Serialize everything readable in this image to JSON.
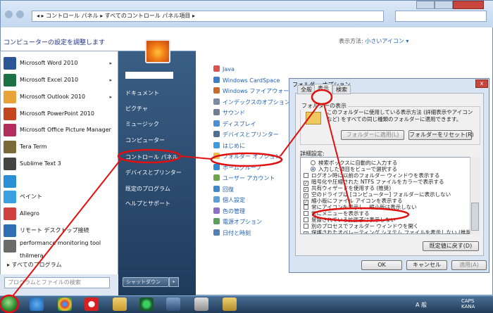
{
  "address": {
    "path": "◂  ▸  コントロール パネル  ▸  すべてのコントロール パネル項目  ▸"
  },
  "control_panel": {
    "heading": "コンピューターの設定を調整します",
    "view_label": "表示方法:",
    "view_value": "小さいアイコン ▾",
    "items": [
      {
        "label": "Java",
        "color": "#d9534f"
      },
      {
        "label": "Windows CardSpace",
        "color": "#3f7ec8"
      },
      {
        "label": "Windows ファイアウォール",
        "color": "#c96b2c"
      },
      {
        "label": "インデックスのオプション",
        "color": "#7a8aa0"
      },
      {
        "label": "サウンド",
        "color": "#6f7f8f"
      },
      {
        "label": "ディスプレイ",
        "color": "#4b8fd6"
      },
      {
        "label": "デバイスとプリンター",
        "color": "#4f6f8f"
      },
      {
        "label": "はじめに",
        "color": "#3b9be0"
      },
      {
        "label": "フォルダー オプション",
        "color": "#e8c04a"
      },
      {
        "label": "ホームグループ",
        "color": "#2d8bd6"
      },
      {
        "label": "ユーザー アカウント",
        "color": "#6fa34a"
      },
      {
        "label": "回復",
        "color": "#3f88c7"
      },
      {
        "label": "個人設定",
        "color": "#5a9fd6"
      },
      {
        "label": "色の管理",
        "color": "#8a6fc4"
      },
      {
        "label": "電源オプション",
        "color": "#58a05a"
      },
      {
        "label": "日付と時刻",
        "color": "#4f7fb5"
      }
    ]
  },
  "start_menu": {
    "programs": [
      {
        "label": "Microsoft Word 2010",
        "color": "#2b5797",
        "arrow": "▸"
      },
      {
        "label": "Microsoft Excel 2010",
        "color": "#1e7145",
        "arrow": "▸"
      },
      {
        "label": "Microsoft Outlook 2010",
        "color": "#e8a33a",
        "arrow": "▸"
      },
      {
        "label": "Microsoft PowerPoint 2010",
        "color": "#c4451d",
        "arrow": ""
      },
      {
        "label": "Microsoft Office Picture Manager",
        "color": "#b22d5b",
        "arrow": ""
      },
      {
        "label": "Tera Term",
        "color": "#7b6a3a",
        "arrow": ""
      },
      {
        "label": "Sublime Text 3",
        "color": "#444444",
        "arrow": ""
      },
      {
        "label": "",
        "color": "#2b8fd6",
        "arrow": ""
      },
      {
        "label": "ペイント",
        "color": "#3aa0e0",
        "arrow": ""
      },
      {
        "label": "Allegro",
        "color": "#d04040",
        "arrow": ""
      },
      {
        "label": "リモート デスクトップ接続",
        "color": "#2f6fb3",
        "arrow": ""
      },
      {
        "label": "performance monitoring tool",
        "label2": "thilmera",
        "color": "#6b6b6b",
        "arrow": ""
      }
    ],
    "all_programs": "▸  すべてのプログラム",
    "search_placeholder": "プログラムとファイルの検索",
    "right_items": [
      "ドキュメント",
      "ピクチャ",
      "ミュージック",
      "コンピューター",
      "コントロール パネル",
      "デバイスとプリンター",
      "既定のプログラム",
      "ヘルプとサポート"
    ],
    "shutdown": "シャットダウン",
    "shutdown_arrow": "▸"
  },
  "dialog": {
    "title": "フォルダー オプション",
    "close": "x",
    "tabs": [
      "全般",
      "表示",
      "検索"
    ],
    "group_title": "フォルダーの表示",
    "group_text": "このフォルダーに使用している表示方法 (詳細表示やアイコンなど) をすべての同じ種類のフォルダーに適用できます。",
    "apply_folders": "フォルダーに適用(L)",
    "reset_folders": "フォルダーをリセット(R)",
    "adv_title": "詳細設定:",
    "adv_items": [
      {
        "label": "検索ボックスに自動的に入力する",
        "kind": "radio",
        "checked": false
      },
      {
        "label": "入力した項目をビューで選択する",
        "kind": "radio",
        "checked": true
      },
      {
        "label": "ログオン時に以前のフォルダー ウィンドウを表示する",
        "kind": "check",
        "checked": false
      },
      {
        "label": "暗号化や圧縮された NTFS ファイルをカラーで表示する",
        "kind": "check",
        "checked": true
      },
      {
        "label": "共有ウィザードを使用する (推奨)",
        "kind": "check",
        "checked": true
      },
      {
        "label": "空のドライブは [コンピューター] フォルダーに表示しない",
        "kind": "check",
        "checked": true
      },
      {
        "label": "縮小版にファイル アイコンを表示する",
        "kind": "check",
        "checked": true
      },
      {
        "label": "常にアイコンを表示し、縮小版は表示しない",
        "kind": "check",
        "checked": false
      },
      {
        "label": "常にメニューを表示する",
        "kind": "check",
        "checked": false
      },
      {
        "label": "登録されている拡張子は表示しない",
        "kind": "check",
        "checked": false
      },
      {
        "label": "別のプロセスでフォルダー ウィンドウを開く",
        "kind": "check",
        "checked": false
      },
      {
        "label": "保護されたオペレーティング システム ファイルを表示しない (推奨)",
        "kind": "check",
        "checked": true
      }
    ],
    "restore_defaults": "既定値に戻す(D)",
    "ok": "OK",
    "cancel": "キャンセル",
    "apply": "適用(A)"
  },
  "taskbar": {
    "clock_lines": [
      "CAPS",
      "KANA"
    ],
    "ime": "A 般"
  },
  "annotation_color": "#e01010"
}
